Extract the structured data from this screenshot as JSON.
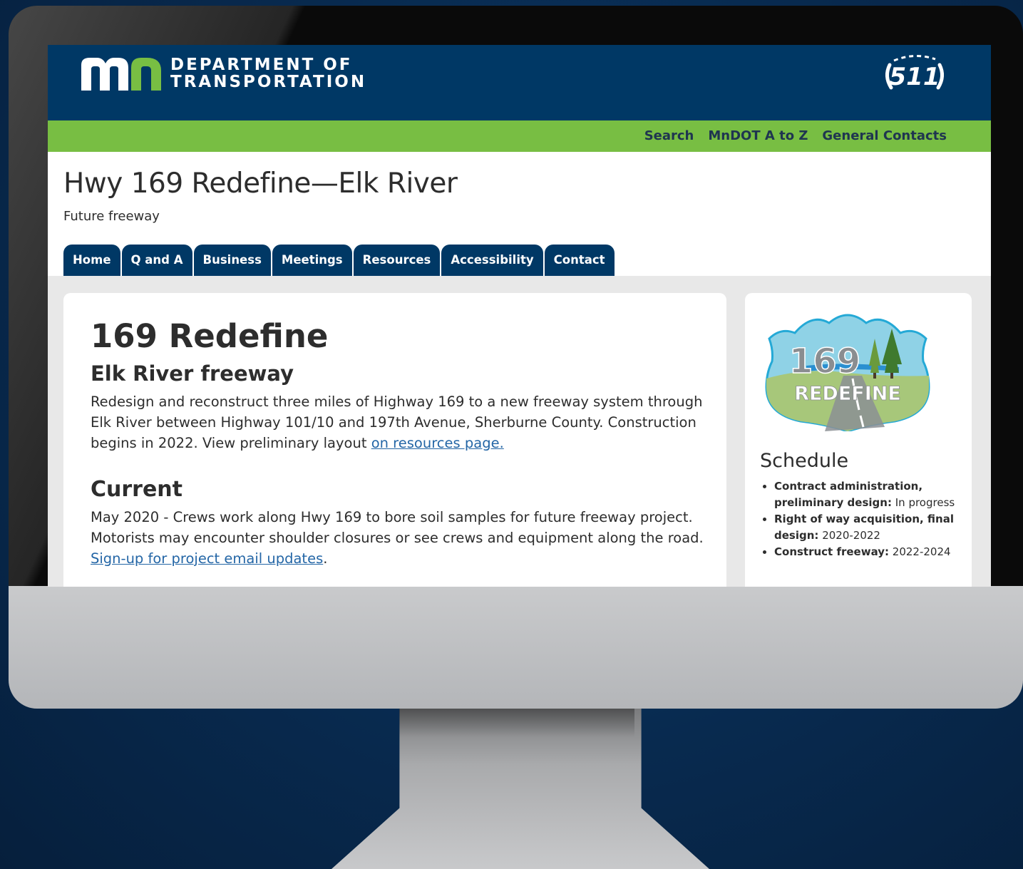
{
  "header": {
    "logo_line1": "DEPARTMENT OF",
    "logo_line2": "TRANSPORTATION",
    "badge_511": "511"
  },
  "utility_nav": [
    "Search",
    "MnDOT A to Z",
    "General Contacts"
  ],
  "page": {
    "title": "Hwy 169 Redefine—Elk River",
    "subtitle": "Future freeway"
  },
  "tabs": [
    "Home",
    "Q and A",
    "Business",
    "Meetings",
    "Resources",
    "Accessibility",
    "Contact"
  ],
  "main": {
    "title": "169 Redefine",
    "subtitle": "Elk River freeway",
    "paragraph_text": "Redesign and reconstruct three miles of Highway 169 to a new freeway system through Elk River between Highway 101/10 and 197th Avenue, Sherburne County. Construction begins in 2022. View preliminary layout ",
    "paragraph_link": "on resources page.",
    "current_title": "Current",
    "current_text": "May 2020 - Crews work along Hwy 169 to bore soil samples for future freeway project. Motorists may encounter shoulder closures or see crews and equipment along the road. ",
    "current_link": "Sign-up for project email updates",
    "current_after": "."
  },
  "sidebar": {
    "logo_number": "169",
    "logo_word": "REDEFINE",
    "schedule_title": "Schedule",
    "schedule": [
      {
        "label": "Contract administration, preliminary design:",
        "value": "In progress"
      },
      {
        "label": "Right of way acquisition, final design:",
        "value": "2020-2022"
      },
      {
        "label": "Construct freeway:",
        "value": "2022-2024"
      }
    ]
  },
  "colors": {
    "navy": "#003865",
    "green": "#78be43",
    "link": "#2466a6"
  }
}
